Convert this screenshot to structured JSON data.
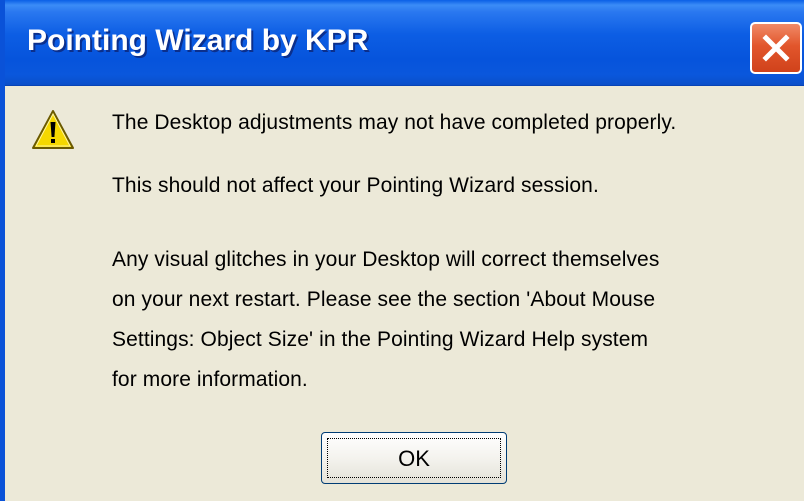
{
  "window": {
    "title": "Pointing Wizard by KPR",
    "close_icon": "close-icon",
    "title_bar_color": "#0a5fe6",
    "close_button_color": "#e2562c"
  },
  "dialog": {
    "icon": "warning-icon",
    "icon_color": "#f5d800",
    "line1": "The Desktop adjustments may not have completed properly.",
    "line2": "This should not affect your Pointing Wizard session.",
    "paragraph": [
      "Any visual glitches in your Desktop will correct themselves",
      "on your next restart. Please see the section 'About Mouse",
      "Settings: Object Size' in the Pointing Wizard Help system",
      "for more information."
    ]
  },
  "buttons": {
    "ok_label": "OK"
  }
}
